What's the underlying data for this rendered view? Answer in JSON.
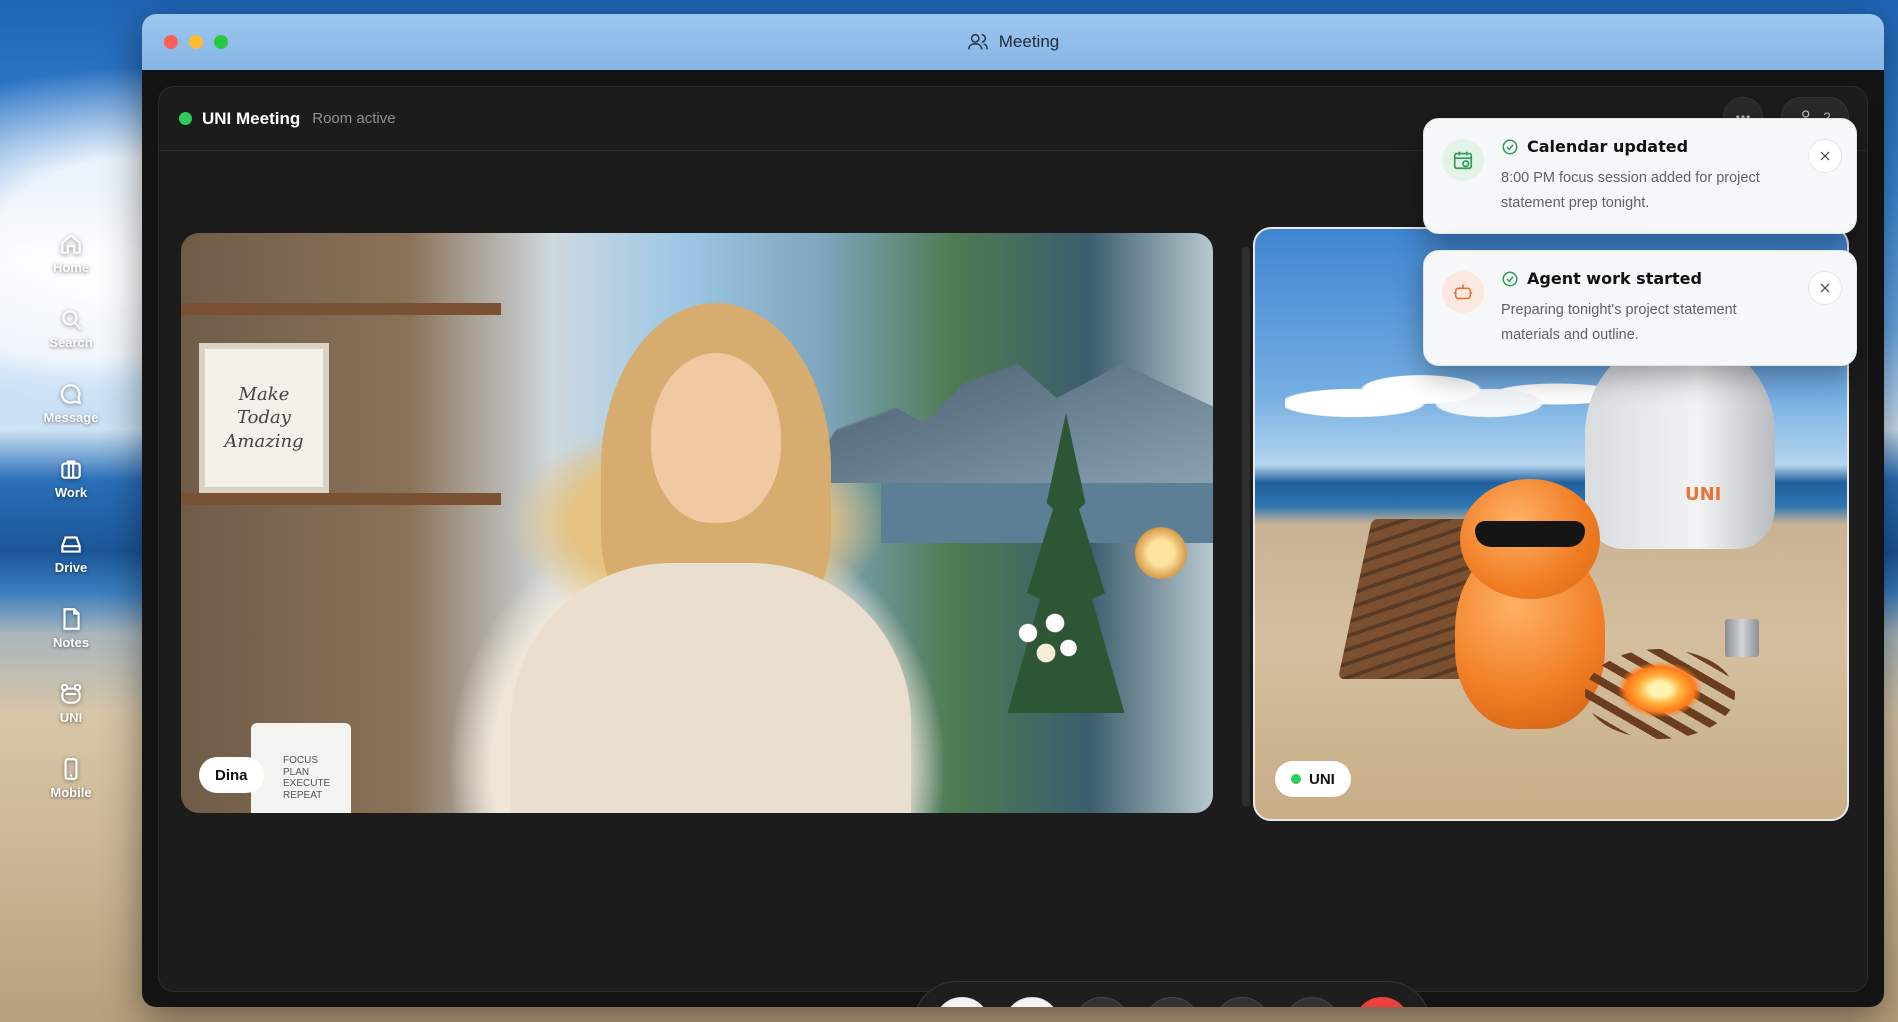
{
  "window": {
    "title": "Meeting"
  },
  "dock": {
    "items": [
      {
        "label": "Home",
        "icon": "home-icon"
      },
      {
        "label": "Search",
        "icon": "search-icon"
      },
      {
        "label": "Message",
        "icon": "message-icon"
      },
      {
        "label": "Work",
        "icon": "briefcase-icon"
      },
      {
        "label": "Drive",
        "icon": "drive-icon"
      },
      {
        "label": "Notes",
        "icon": "notes-icon"
      },
      {
        "label": "UNI",
        "icon": "uni-bear-icon"
      },
      {
        "label": "Mobile",
        "icon": "mobile-icon"
      }
    ]
  },
  "room": {
    "name": "UNI Meeting",
    "status": "Room active",
    "status_color": "#2ecc58",
    "participant_count": "2"
  },
  "participants": {
    "dina": {
      "name": "Dina",
      "mug_text": "FOCUS\nPLAN\nEXECUTE\nREPEAT",
      "art_text": "Make\nToday\nAmazing"
    },
    "uni": {
      "name": "UNI",
      "capsule_logo": "UNI"
    }
  },
  "notifications": [
    {
      "title": "Calendar updated",
      "body": "8:00 PM focus session added for project statement prep tonight.",
      "icon": "calendar-icon",
      "accent": "#2e9b53"
    },
    {
      "title": "Agent work started",
      "body": "Preparing tonight's project statement materials and outline.",
      "icon": "robot-icon",
      "accent": "#e2753a"
    }
  ],
  "controls": {
    "buttons": [
      {
        "name": "microphone-button",
        "icon": "microphone-icon"
      },
      {
        "name": "camera-button",
        "icon": "video-camera-icon"
      },
      {
        "name": "share-screen-button",
        "icon": "screen-share-icon"
      },
      {
        "name": "reactions-button",
        "icon": "smiley-icon"
      },
      {
        "name": "raise-hand-button",
        "icon": "hand-icon"
      },
      {
        "name": "more-options-button",
        "icon": "more-icon"
      },
      {
        "name": "end-call-button",
        "icon": "phone-hangup-icon"
      }
    ],
    "end_call_color": "#ee3f3f"
  }
}
